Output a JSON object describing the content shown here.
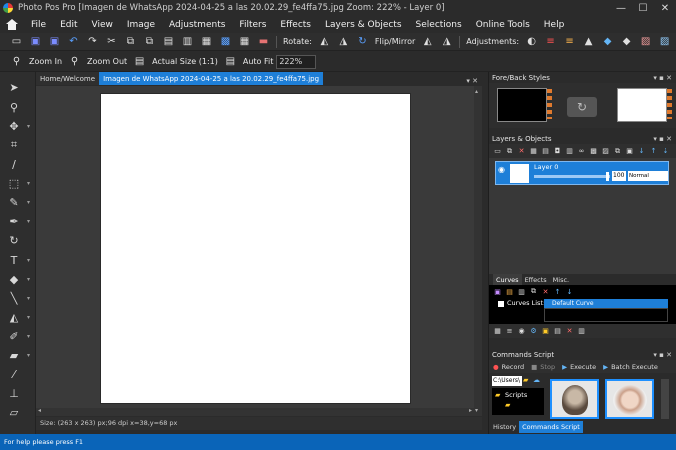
{
  "window": {
    "title": "Photo Pos Pro [Imagen de WhatsApp 2024-04-25 a las 20.02.29_fe4ffa75.jpg Zoom: 222% - Layer 0]",
    "minimize": "—",
    "maximize": "☐",
    "close": "✕"
  },
  "menu": {
    "items": [
      "File",
      "Edit",
      "View",
      "Image",
      "Adjustments",
      "Filters",
      "Effects",
      "Layers & Objects",
      "Selections",
      "Online Tools",
      "Help"
    ]
  },
  "toolbar1": {
    "rotate_label": "Rotate:",
    "flip_label": "Flip/Mirror",
    "adjustments_label": "Adjustments:"
  },
  "toolbar2": {
    "zoom_in": "Zoom In",
    "zoom_out": "Zoom Out",
    "actual_size": "Actual Size (1:1)",
    "auto_fit": "Auto Fit",
    "zoom_value": "222%"
  },
  "tabs": {
    "home": "Home/Welcome",
    "document": "Imagen de WhatsApp 2024-04-25 a las 20.02.29_fe4ffa75.jpg"
  },
  "doc_status": "Size: (263 x 263) px;96 dpi   x=38,y=68 px",
  "status_bar": "For help please press F1",
  "panels": {
    "fore_back": "Fore/Back Styles",
    "layers": "Layers & Objects",
    "layer_name": "Layer 0",
    "opacity": "100",
    "blend_mode": "Normal",
    "curves_tabs": [
      "Curves",
      "Effects",
      "Misc."
    ],
    "curves_list_label": "Curves List:",
    "curves_item": "Default Curve",
    "commands_script": "Commands Script",
    "record": "Record",
    "stop": "Stop",
    "execute": "Execute",
    "batch_execute": "Batch Execute",
    "path": "C:\\Users\\",
    "scripts_folder": "Scripts",
    "bottom_tabs": [
      "History",
      "Commands Script"
    ]
  },
  "colors": {
    "accent": "#1e7fd8",
    "status_bar": "#0a64b8",
    "background": "#2b2b2b",
    "canvas": "#ffffff"
  }
}
